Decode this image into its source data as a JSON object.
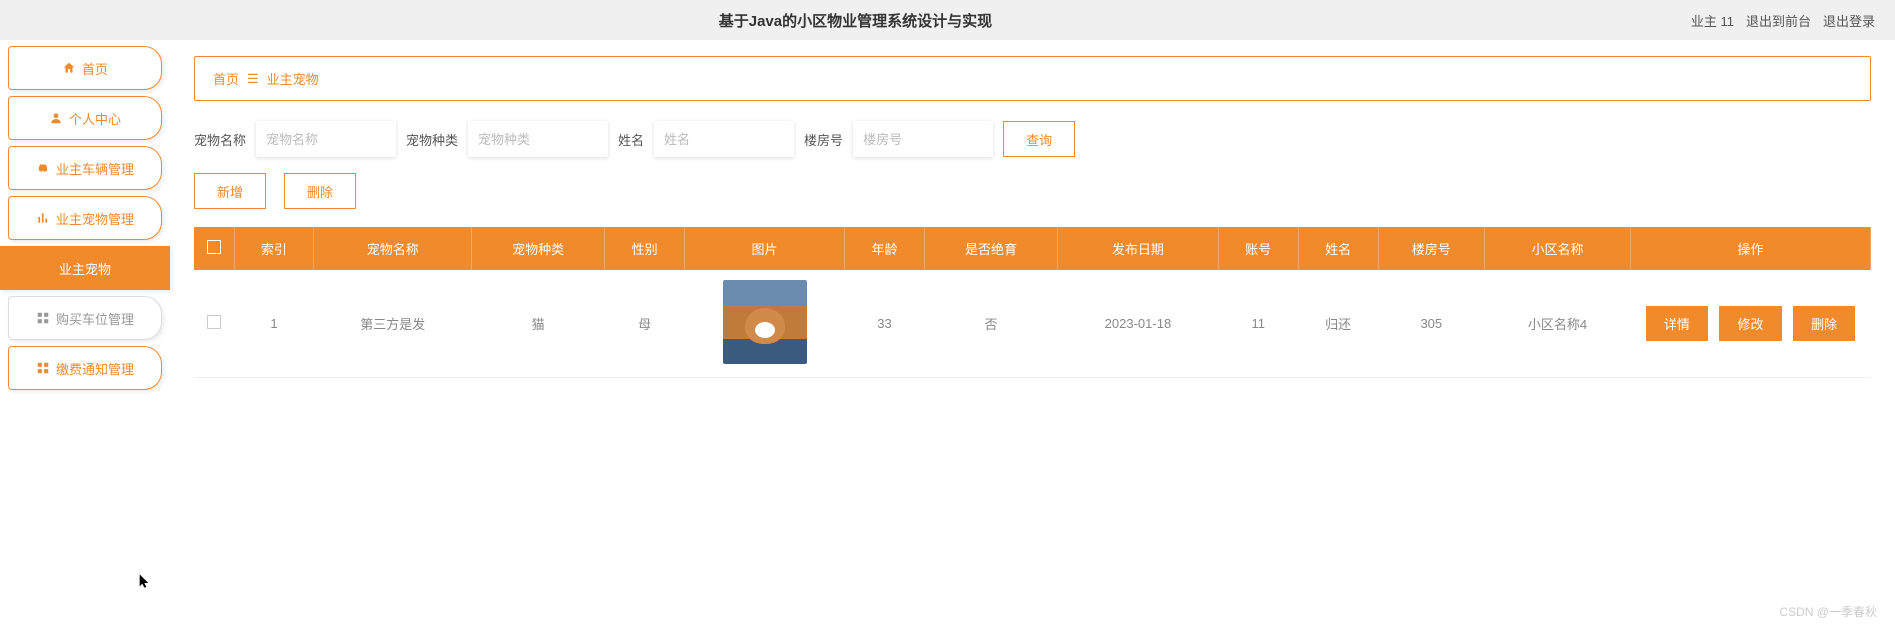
{
  "header": {
    "title": "基于Java的小区物业管理系统设计与实现",
    "user": "业主 11",
    "to_front": "退出到前台",
    "logout": "退出登录"
  },
  "sidebar": {
    "items": [
      {
        "icon": "home",
        "label": "首页"
      },
      {
        "icon": "user",
        "label": "个人中心"
      },
      {
        "icon": "car",
        "label": "业主车辆管理"
      },
      {
        "icon": "bar",
        "label": "业主宠物管理"
      },
      {
        "icon": "",
        "label": "业主宠物",
        "active": true
      },
      {
        "icon": "grid",
        "label": "购买车位管理",
        "gray": true
      },
      {
        "icon": "grid",
        "label": "缴费通知管理"
      }
    ]
  },
  "breadcrumb": {
    "home": "首页",
    "current": "业主宠物"
  },
  "search": {
    "name_label": "宠物名称",
    "name_ph": "宠物名称",
    "type_label": "宠物种类",
    "type_ph": "宠物种类",
    "owner_label": "姓名",
    "owner_ph": "姓名",
    "room_label": "楼房号",
    "room_ph": "楼房号",
    "query": "查询"
  },
  "actions": {
    "add": "新增",
    "del": "删除"
  },
  "table": {
    "headers": [
      "",
      "索引",
      "宠物名称",
      "宠物种类",
      "性别",
      "图片",
      "年龄",
      "是否绝育",
      "发布日期",
      "账号",
      "姓名",
      "楼房号",
      "小区名称",
      "操作"
    ],
    "row": {
      "index": "1",
      "name": "第三方是发",
      "type": "猫",
      "gender": "母",
      "age": "33",
      "neutered": "否",
      "date": "2023-01-18",
      "account": "11",
      "owner": "归还",
      "room": "305",
      "community": "小区名称4"
    },
    "ops": {
      "detail": "详情",
      "edit": "修改",
      "delete": "删除"
    }
  },
  "watermark": "CSDN @一季春秋"
}
